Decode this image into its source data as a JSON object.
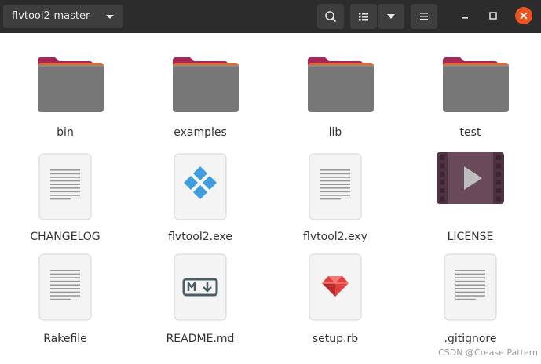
{
  "window": {
    "path": "flvtool2-master",
    "colors": {
      "header_bg": "#2c2c2c",
      "button_bg": "#3e3e3e",
      "close": "#e95420"
    },
    "icons": [
      "chevron-down-icon",
      "search-icon",
      "list-view-icon",
      "view-options-chevron-icon",
      "hamburger-menu-icon",
      "minimize-icon",
      "maximize-icon",
      "close-icon"
    ]
  },
  "files": [
    {
      "name": "bin",
      "type": "folder"
    },
    {
      "name": "examples",
      "type": "folder"
    },
    {
      "name": "lib",
      "type": "folder"
    },
    {
      "name": "test",
      "type": "folder"
    },
    {
      "name": "CHANGELOG",
      "type": "text-file"
    },
    {
      "name": "flvtool2.exe",
      "type": "windows-executable"
    },
    {
      "name": "flvtool2.exy",
      "type": "text-file"
    },
    {
      "name": "LICENSE",
      "type": "video-file"
    },
    {
      "name": "Rakefile",
      "type": "text-file"
    },
    {
      "name": "README.md",
      "type": "markdown-file"
    },
    {
      "name": "setup.rb",
      "type": "ruby-file"
    },
    {
      "name": ".gitignore",
      "type": "text-file"
    }
  ],
  "watermark": "CSDN @Crease Pattern"
}
